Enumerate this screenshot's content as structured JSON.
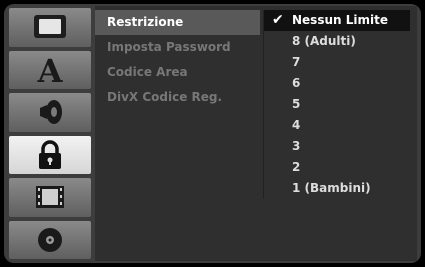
{
  "sidebar": {
    "items": [
      {
        "name": "tv-screen-icon",
        "active": false
      },
      {
        "name": "language-a-icon",
        "label": "A",
        "active": false
      },
      {
        "name": "speaker-icon",
        "active": false
      },
      {
        "name": "padlock-icon",
        "active": true
      },
      {
        "name": "film-strip-icon",
        "active": false
      },
      {
        "name": "disc-icon",
        "active": false
      }
    ]
  },
  "menu": {
    "items": [
      {
        "label": "Restrizione",
        "selected": true
      },
      {
        "label": "Imposta Password",
        "selected": false
      },
      {
        "label": "Codice Area",
        "selected": false
      },
      {
        "label": "DivX Codice Reg.",
        "selected": false
      }
    ]
  },
  "options": {
    "check_glyph": "✔",
    "items": [
      {
        "label": "Nessun Limite",
        "selected": true
      },
      {
        "label": "8 (Adulti)"
      },
      {
        "label": "7"
      },
      {
        "label": "6"
      },
      {
        "label": "5"
      },
      {
        "label": "4"
      },
      {
        "label": "3"
      },
      {
        "label": "2"
      },
      {
        "label": "1 (Bambini)"
      }
    ]
  }
}
